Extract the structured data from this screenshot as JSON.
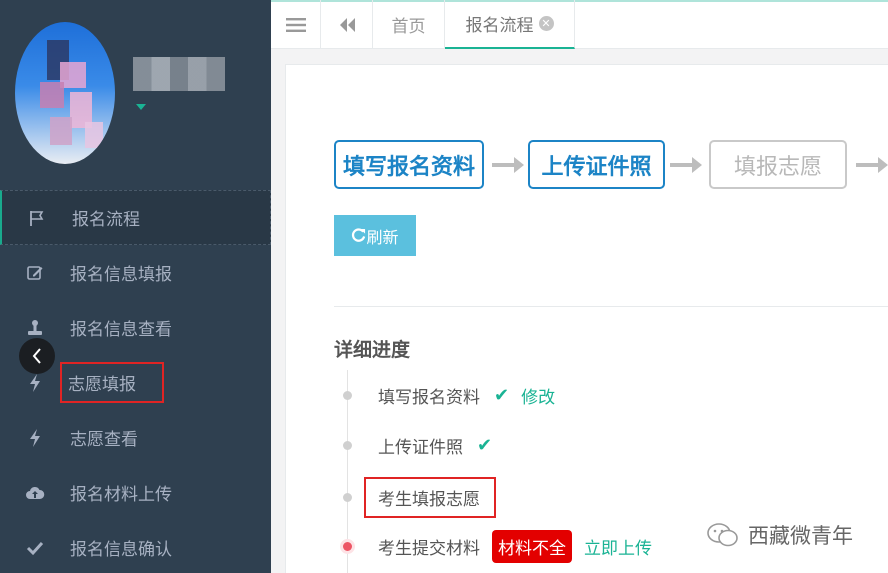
{
  "sidebar": {
    "items": [
      {
        "label": "报名流程",
        "icon": "flag-icon"
      },
      {
        "label": "报名信息填报",
        "icon": "edit-icon"
      },
      {
        "label": "报名信息查看",
        "icon": "stamp-icon"
      },
      {
        "label": "志愿填报",
        "icon": "bolt-icon"
      },
      {
        "label": "志愿查看",
        "icon": "bolt-icon"
      },
      {
        "label": "报名材料上传",
        "icon": "cloud-upload-icon"
      },
      {
        "label": "报名信息确认",
        "icon": "check-icon"
      }
    ],
    "collapse_icon": "chevron-left-icon"
  },
  "tabs": {
    "menu_icon": "hamburger-icon",
    "back_icon": "double-chevron-left-icon",
    "home": "首页",
    "flow": "报名流程",
    "close_icon": "close-circle-icon"
  },
  "steps": [
    {
      "label": "填写报名资料",
      "state": "active"
    },
    {
      "label": "上传证件照",
      "state": "active"
    },
    {
      "label": "填报志愿",
      "state": "pending"
    }
  ],
  "refresh_label": "刷新",
  "progress": {
    "title": "详细进度",
    "items": [
      {
        "label": "填写报名资料",
        "check": "✔",
        "link": "修改"
      },
      {
        "label": "上传证件照",
        "check": "✔"
      },
      {
        "label": "考生填报志愿"
      },
      {
        "label": "考生提交材料",
        "badge": "材料不全",
        "link": "立即上传"
      }
    ]
  },
  "watermark": "西藏微青年",
  "colors": {
    "accent": "#1ab394",
    "step_blue": "#1c84c6",
    "sidebar_bg": "#2f4050",
    "alert_red": "#e30000",
    "refresh_btn": "#5bc0de"
  }
}
